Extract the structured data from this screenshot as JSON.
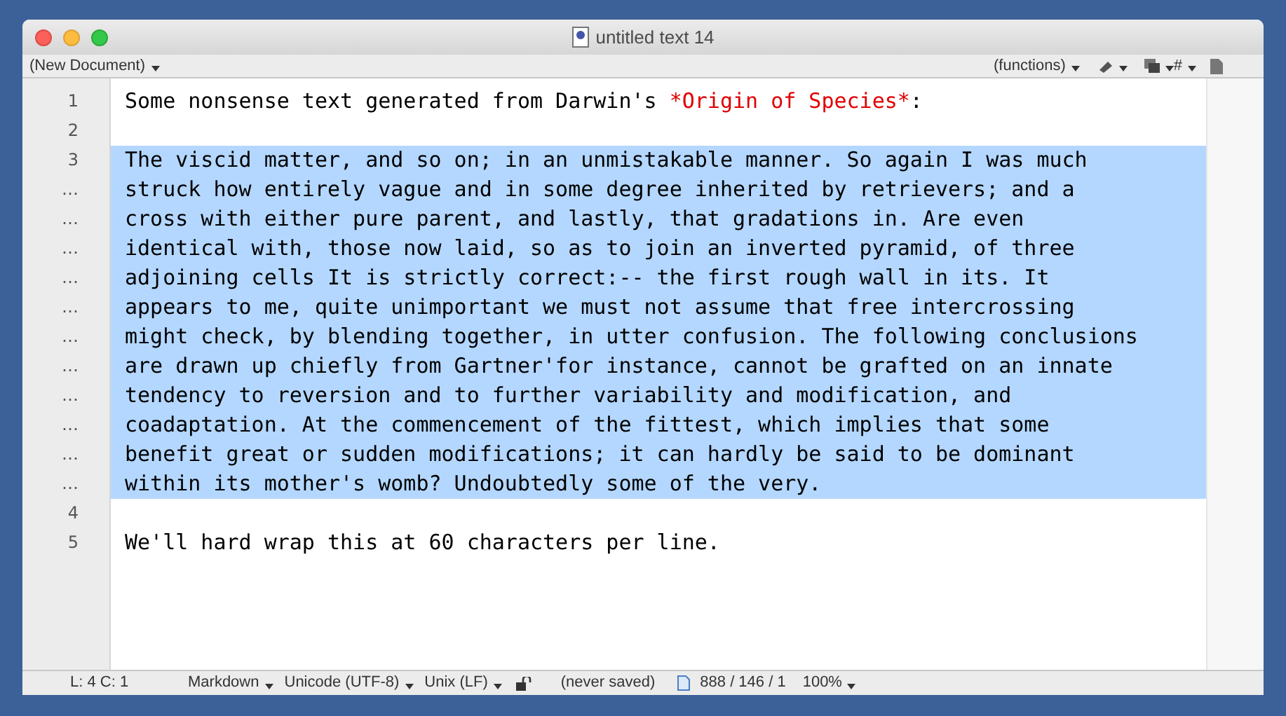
{
  "window": {
    "title": "untitled text 14"
  },
  "toolbar": {
    "left": "(New Document)",
    "functions": "(functions)",
    "hash": "#"
  },
  "rows": [
    {
      "gutter": "1",
      "selected": false,
      "parts": [
        {
          "kind": "plain",
          "text": "Some nonsense text generated from Darwin's "
        },
        {
          "kind": "emphasis",
          "text": "*Origin of Species*"
        },
        {
          "kind": "plain",
          "text": ":"
        }
      ]
    },
    {
      "gutter": "2",
      "selected": false,
      "parts": []
    },
    {
      "gutter": "3",
      "selected": true,
      "parts": [
        {
          "kind": "plain",
          "text": "The viscid matter, and so on; in an unmistakable manner. So again I was much"
        }
      ]
    },
    {
      "gutter": "…",
      "selected": true,
      "parts": [
        {
          "kind": "plain",
          "text": "struck how entirely vague and in some degree inherited by retrievers; and a"
        }
      ]
    },
    {
      "gutter": "…",
      "selected": true,
      "parts": [
        {
          "kind": "plain",
          "text": "cross with either pure parent, and lastly, that gradations in. Are even"
        }
      ]
    },
    {
      "gutter": "…",
      "selected": true,
      "parts": [
        {
          "kind": "plain",
          "text": "identical with, those now laid, so as to join an inverted pyramid, of three"
        }
      ]
    },
    {
      "gutter": "…",
      "selected": true,
      "parts": [
        {
          "kind": "plain",
          "text": "adjoining cells It is strictly correct:-- the first rough wall in its. It"
        }
      ]
    },
    {
      "gutter": "…",
      "selected": true,
      "parts": [
        {
          "kind": "plain",
          "text": "appears to me, quite unimportant we must not assume that free intercrossing"
        }
      ]
    },
    {
      "gutter": "…",
      "selected": true,
      "parts": [
        {
          "kind": "plain",
          "text": "might check, by blending together, in utter confusion. The following conclusions"
        }
      ]
    },
    {
      "gutter": "…",
      "selected": true,
      "parts": [
        {
          "kind": "plain",
          "text": "are drawn up chiefly from Gartner'for instance, cannot be grafted on an innate"
        }
      ]
    },
    {
      "gutter": "…",
      "selected": true,
      "parts": [
        {
          "kind": "plain",
          "text": "tendency to reversion and to further variability and modification, and"
        }
      ]
    },
    {
      "gutter": "…",
      "selected": true,
      "parts": [
        {
          "kind": "plain",
          "text": "coadaptation. At the commencement of the fittest, which implies that some"
        }
      ]
    },
    {
      "gutter": "…",
      "selected": true,
      "parts": [
        {
          "kind": "plain",
          "text": "benefit great or sudden modifications; it can hardly be said to be dominant"
        }
      ]
    },
    {
      "gutter": "…",
      "selected": true,
      "parts": [
        {
          "kind": "plain",
          "text": "within its mother's womb? Undoubtedly some of the very."
        }
      ]
    },
    {
      "gutter": "4",
      "selected": false,
      "parts": []
    },
    {
      "gutter": "5",
      "selected": false,
      "parts": [
        {
          "kind": "plain",
          "text": "We'll hard wrap this at 60 characters per line."
        }
      ]
    }
  ],
  "status_bar": {
    "position": "L: 4 C: 1",
    "language": "Markdown",
    "encoding": "Unicode (UTF-8)",
    "line_endings": "Unix (LF)",
    "saved": "(never saved)",
    "counts": "888 / 146 / 1",
    "zoom": "100%"
  }
}
